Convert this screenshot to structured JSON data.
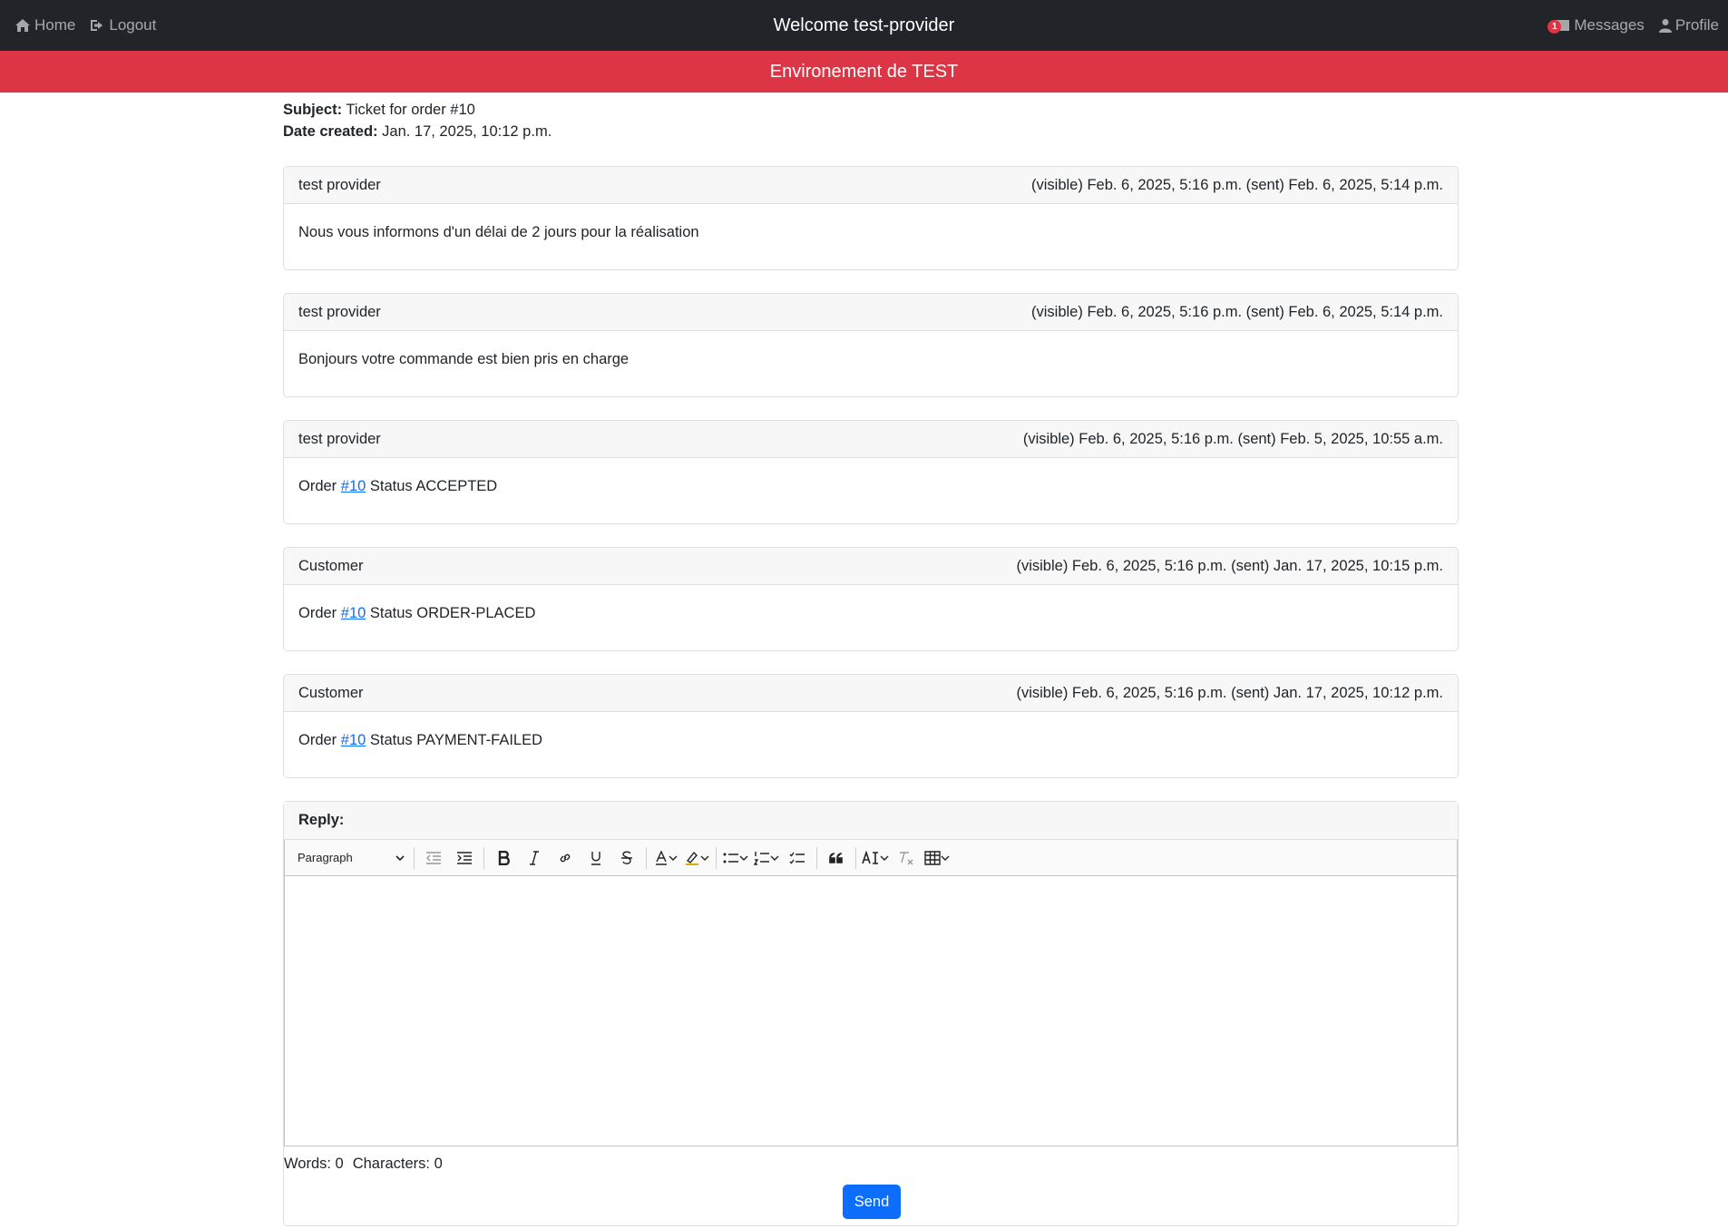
{
  "navbar": {
    "home_label": "Home",
    "logout_label": "Logout",
    "title": "Welcome test-provider",
    "messages_label": "Messages",
    "messages_badge": "1",
    "profile_label": "Profile"
  },
  "banner": {
    "text": "Environement de TEST"
  },
  "ticket": {
    "subject_label": "Subject:",
    "subject": "Ticket for order #10",
    "date_label": "Date created:",
    "date": "Jan. 17, 2025, 10:12 p.m."
  },
  "messages": [
    {
      "author": "test provider",
      "meta": "(visible) Feb. 6, 2025, 5:16 p.m. (sent) Feb. 6, 2025, 5:14 p.m.",
      "text": "Nous vous informons d'un délai de 2 jours pour la réalisation"
    },
    {
      "author": "test provider",
      "meta": "(visible) Feb. 6, 2025, 5:16 p.m. (sent) Feb. 6, 2025, 5:14 p.m.",
      "text": "Bonjours votre commande est bien pris en charge"
    },
    {
      "author": "test provider",
      "meta": "(visible) Feb. 6, 2025, 5:16 p.m. (sent) Feb. 5, 2025, 10:55 a.m.",
      "prefix": "Order",
      "link": "#10",
      "suffix": "Status ACCEPTED"
    },
    {
      "author": "Customer",
      "meta": "(visible) Feb. 6, 2025, 5:16 p.m. (sent) Jan. 17, 2025, 10:15 p.m.",
      "prefix": "Order",
      "link": "#10",
      "suffix": "Status ORDER-PLACED"
    },
    {
      "author": "Customer",
      "meta": "(visible) Feb. 6, 2025, 5:16 p.m. (sent) Jan. 17, 2025, 10:12 p.m.",
      "prefix": "Order",
      "link": "#10",
      "suffix": "Status PAYMENT-FAILED"
    }
  ],
  "reply": {
    "header": "Reply:",
    "paragraph_select": "Paragraph",
    "words_label": "Words: 0",
    "chars_label": "Characters: 0",
    "send_label": "Send"
  },
  "colors": {
    "navbar_bg": "#212529",
    "banner_bg": "#dc3545",
    "link": "#0d6efd",
    "send_button": "#0d6efd",
    "badge": "#dc3545"
  },
  "icons": [
    "home-icon",
    "logout-icon",
    "envelope-icon",
    "user-icon",
    "outdent-icon",
    "indent-icon",
    "bold-icon",
    "italic-icon",
    "link-icon",
    "underline-icon",
    "strikethrough-icon",
    "font-color-icon",
    "highlight-icon",
    "bulleted-list-icon",
    "numbered-list-icon",
    "todo-list-icon",
    "quote-icon",
    "font-size-icon",
    "remove-format-icon",
    "table-icon",
    "chevron-down-icon"
  ]
}
